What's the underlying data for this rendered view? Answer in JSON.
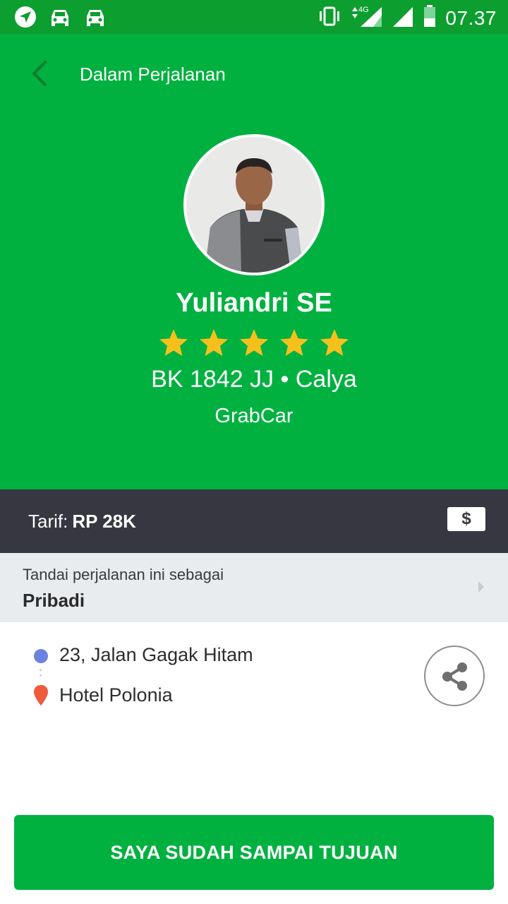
{
  "status_bar": {
    "network": "4G",
    "time": "07.37"
  },
  "header": {
    "title": "Dalam Perjalanan"
  },
  "driver": {
    "name": "Yuliandri SE",
    "rating": 5,
    "plate": "BK 1842 JJ",
    "separator": "•",
    "car_model": "Calya",
    "service": "GrabCar"
  },
  "fare": {
    "label": "Tarif:",
    "value": "RP 28K",
    "payment_icon": "$"
  },
  "tag_trip": {
    "label": "Tandai perjalanan ini sebagai",
    "value": "Pribadi"
  },
  "route": {
    "pickup": "23, Jalan Gagak Hitam",
    "dropoff": "Hotel Polonia"
  },
  "actions": {
    "arrived_label": "SAYA SUDAH SAMPAI TUJUAN"
  },
  "colors": {
    "brand_green": "#00b140",
    "status_green": "#0c9e2f",
    "fare_bar": "#363741",
    "star": "#f6c01c",
    "pickup_dot": "#6b82e0",
    "drop_pin": "#ef5a3c"
  },
  "icons": {
    "status_left": [
      "navigation-icon",
      "car-icon",
      "car-icon"
    ],
    "status_right": [
      "vibrate-icon",
      "signal-icon",
      "signal-icon",
      "battery-icon"
    ],
    "back": "back-arrow-icon",
    "share": "share-icon",
    "chevron": "chevron-right-icon",
    "pin": "location-pin-icon"
  }
}
